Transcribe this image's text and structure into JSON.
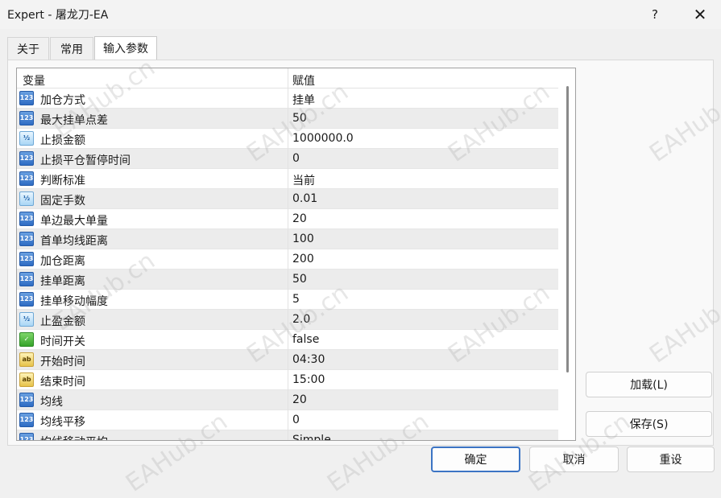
{
  "window": {
    "title": "Expert - 屠龙刀-EA",
    "help_glyph": "?",
    "close_glyph": "✕"
  },
  "tabs": [
    {
      "label": "关于"
    },
    {
      "label": "常用"
    },
    {
      "label": "输入参数"
    }
  ],
  "grid": {
    "headers": {
      "variable": "变量",
      "value": "赋值"
    },
    "rows": [
      {
        "icon": "int",
        "icon_glyph": "123",
        "name": "加仓方式",
        "value": "挂单"
      },
      {
        "icon": "int",
        "icon_glyph": "123",
        "name": "最大挂单点差",
        "value": "50"
      },
      {
        "icon": "dbl",
        "icon_glyph": "½",
        "name": "止损金额",
        "value": "1000000.0"
      },
      {
        "icon": "int",
        "icon_glyph": "123",
        "name": "止损平仓暂停时间",
        "value": "0"
      },
      {
        "icon": "int",
        "icon_glyph": "123",
        "name": "判断标准",
        "value": "当前"
      },
      {
        "icon": "dbl",
        "icon_glyph": "½",
        "name": "固定手数",
        "value": "0.01"
      },
      {
        "icon": "int",
        "icon_glyph": "123",
        "name": "单边最大单量",
        "value": "20"
      },
      {
        "icon": "int",
        "icon_glyph": "123",
        "name": "首单均线距离",
        "value": "100"
      },
      {
        "icon": "int",
        "icon_glyph": "123",
        "name": "加仓距离",
        "value": "200"
      },
      {
        "icon": "int",
        "icon_glyph": "123",
        "name": "挂单距离",
        "value": "50"
      },
      {
        "icon": "int",
        "icon_glyph": "123",
        "name": "挂单移动幅度",
        "value": "5"
      },
      {
        "icon": "dbl",
        "icon_glyph": "½",
        "name": "止盈金额",
        "value": "2.0"
      },
      {
        "icon": "bool",
        "icon_glyph": "✓",
        "name": "时间开关",
        "value": "false"
      },
      {
        "icon": "str",
        "icon_glyph": "ab",
        "name": "开始时间",
        "value": "04:30"
      },
      {
        "icon": "str",
        "icon_glyph": "ab",
        "name": "结束时间",
        "value": "15:00"
      },
      {
        "icon": "int",
        "icon_glyph": "123",
        "name": "均线",
        "value": "20"
      },
      {
        "icon": "int",
        "icon_glyph": "123",
        "name": "均线平移",
        "value": "0"
      },
      {
        "icon": "int",
        "icon_glyph": "123",
        "name": "均线移动平均",
        "value": "Simple"
      }
    ]
  },
  "buttons": {
    "load": "加载(L)",
    "save": "保存(S)",
    "ok": "确定",
    "cancel": "取消",
    "reset": "重设"
  },
  "watermark": "EAHub.cn",
  "colors": {
    "ok_border": "#3c74c4",
    "row_alt": "#ececec"
  }
}
